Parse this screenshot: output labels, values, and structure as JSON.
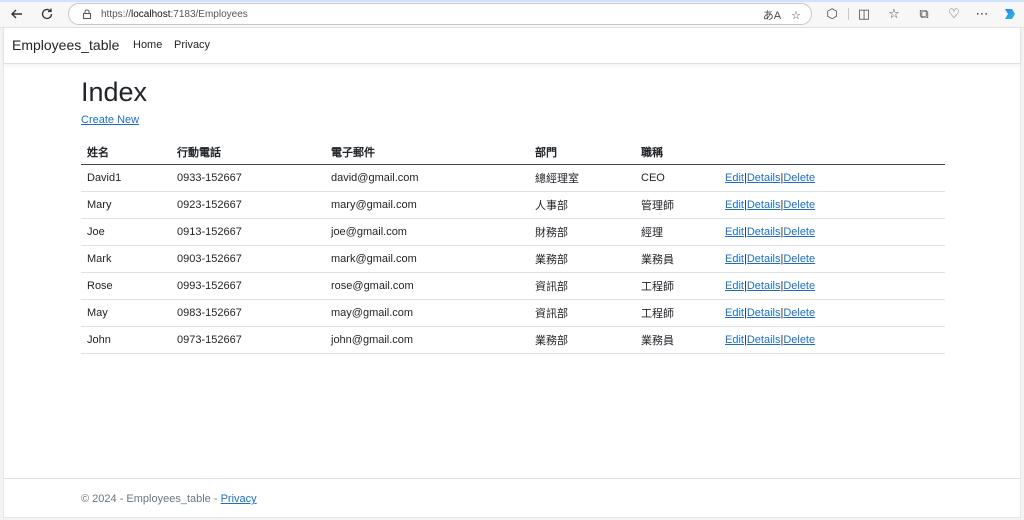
{
  "browser": {
    "url_prefix": "https://",
    "url_host": "localhost",
    "url_rest": ":7183/Employees"
  },
  "nav": {
    "brand": "Employees_table",
    "links": [
      "Home",
      "Privacy"
    ]
  },
  "main": {
    "title": "Index",
    "create_link": "Create New",
    "table": {
      "headers": [
        "姓名",
        "行動電話",
        "電子郵件",
        "部門",
        "職稱"
      ],
      "rows": [
        {
          "name": "David1",
          "phone": "0933-152667",
          "email": "david@gmail.com",
          "dept": "總經理室",
          "title": "CEO"
        },
        {
          "name": "Mary",
          "phone": "0923-152667",
          "email": "mary@gmail.com",
          "dept": "人事部",
          "title": "管理師"
        },
        {
          "name": "Joe",
          "phone": "0913-152667",
          "email": "joe@gmail.com",
          "dept": "財務部",
          "title": "經理"
        },
        {
          "name": "Mark",
          "phone": "0903-152667",
          "email": "mark@gmail.com",
          "dept": "業務部",
          "title": "業務員"
        },
        {
          "name": "Rose",
          "phone": "0993-152667",
          "email": "rose@gmail.com",
          "dept": "資訊部",
          "title": "工程師"
        },
        {
          "name": "May",
          "phone": "0983-152667",
          "email": "may@gmail.com",
          "dept": "資訊部",
          "title": "工程師"
        },
        {
          "name": "John",
          "phone": "0973-152667",
          "email": "john@gmail.com",
          "dept": "業務部",
          "title": "業務員"
        }
      ],
      "actions": {
        "edit": "Edit",
        "details": "Details",
        "delete": "Delete",
        "separator": "|"
      }
    }
  },
  "footer": {
    "text": "© 2024 - Employees_table - ",
    "link": "Privacy"
  },
  "colors": {
    "link": "#1b6ec2",
    "text": "#212529",
    "muted": "#6c757d"
  },
  "icons": [
    "back-icon",
    "refresh-icon",
    "lock-icon",
    "read-aloud-icon",
    "favorite-star-icon",
    "extensions-icon",
    "split-screen-icon",
    "favorites-icon",
    "collections-icon",
    "browser-essentials-icon",
    "more-icon",
    "copilot-icon"
  ]
}
